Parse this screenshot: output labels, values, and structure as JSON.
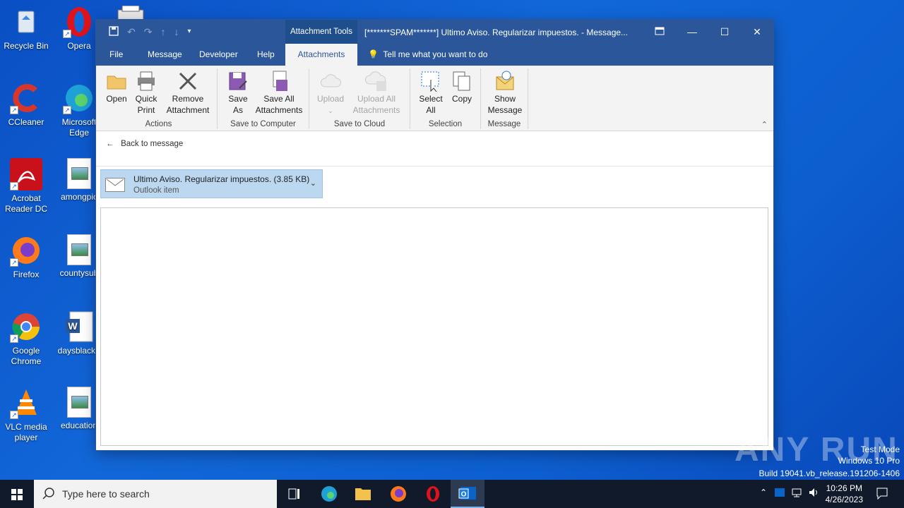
{
  "desktop": {
    "icons": [
      {
        "label": "Recycle Bin"
      },
      {
        "label": "Opera"
      },
      {
        "label": "CCleaner"
      },
      {
        "label": "Microsoft Edge"
      },
      {
        "label": "Acrobat Reader DC"
      },
      {
        "label": "amongpic"
      },
      {
        "label": "Firefox"
      },
      {
        "label": "countysub"
      },
      {
        "label": "Google Chrome"
      },
      {
        "label": "daysblack.r"
      },
      {
        "label": "VLC media player"
      },
      {
        "label": "education"
      }
    ]
  },
  "window": {
    "context_tab": "Attachment Tools",
    "title": "[*******SPAM*******] Ultimo Aviso. Regularizar impuestos.  -  Message...",
    "tabs": [
      "File",
      "Message",
      "Developer",
      "Help",
      "Attachments"
    ],
    "active_tab": "Attachments",
    "tell_me": "Tell me what you want to do",
    "ribbon": {
      "open": "Open",
      "quick_print": "Quick Print",
      "remove_attachment": "Remove Attachment",
      "group_actions": "Actions",
      "save_as": "Save As",
      "save_all": "Save All Attachments",
      "group_save_computer": "Save to Computer",
      "upload": "Upload",
      "upload_all": "Upload All Attachments",
      "group_save_cloud": "Save to Cloud",
      "select_all": "Select All",
      "copy": "Copy",
      "group_selection": "Selection",
      "show_message": "Show Message",
      "group_message": "Message"
    },
    "back_to_message": "Back to message",
    "attachment": {
      "name": "Ultimo Aviso. Regularizar impuestos. (3.85 KB)",
      "type": "Outlook item"
    }
  },
  "watermark": {
    "brand": "ANY RUN",
    "line1": "Test Mode",
    "line2": "Windows 10 Pro",
    "line3": "Build 19041.vb_release.191206-1406"
  },
  "taskbar": {
    "search_placeholder": "Type here to search",
    "time": "10:26 PM",
    "date": "4/26/2023"
  },
  "colors": {
    "outlook_blue": "#2b579a",
    "desktop_blue": "#1267d8",
    "attachment_selected": "#bcd8f0"
  }
}
